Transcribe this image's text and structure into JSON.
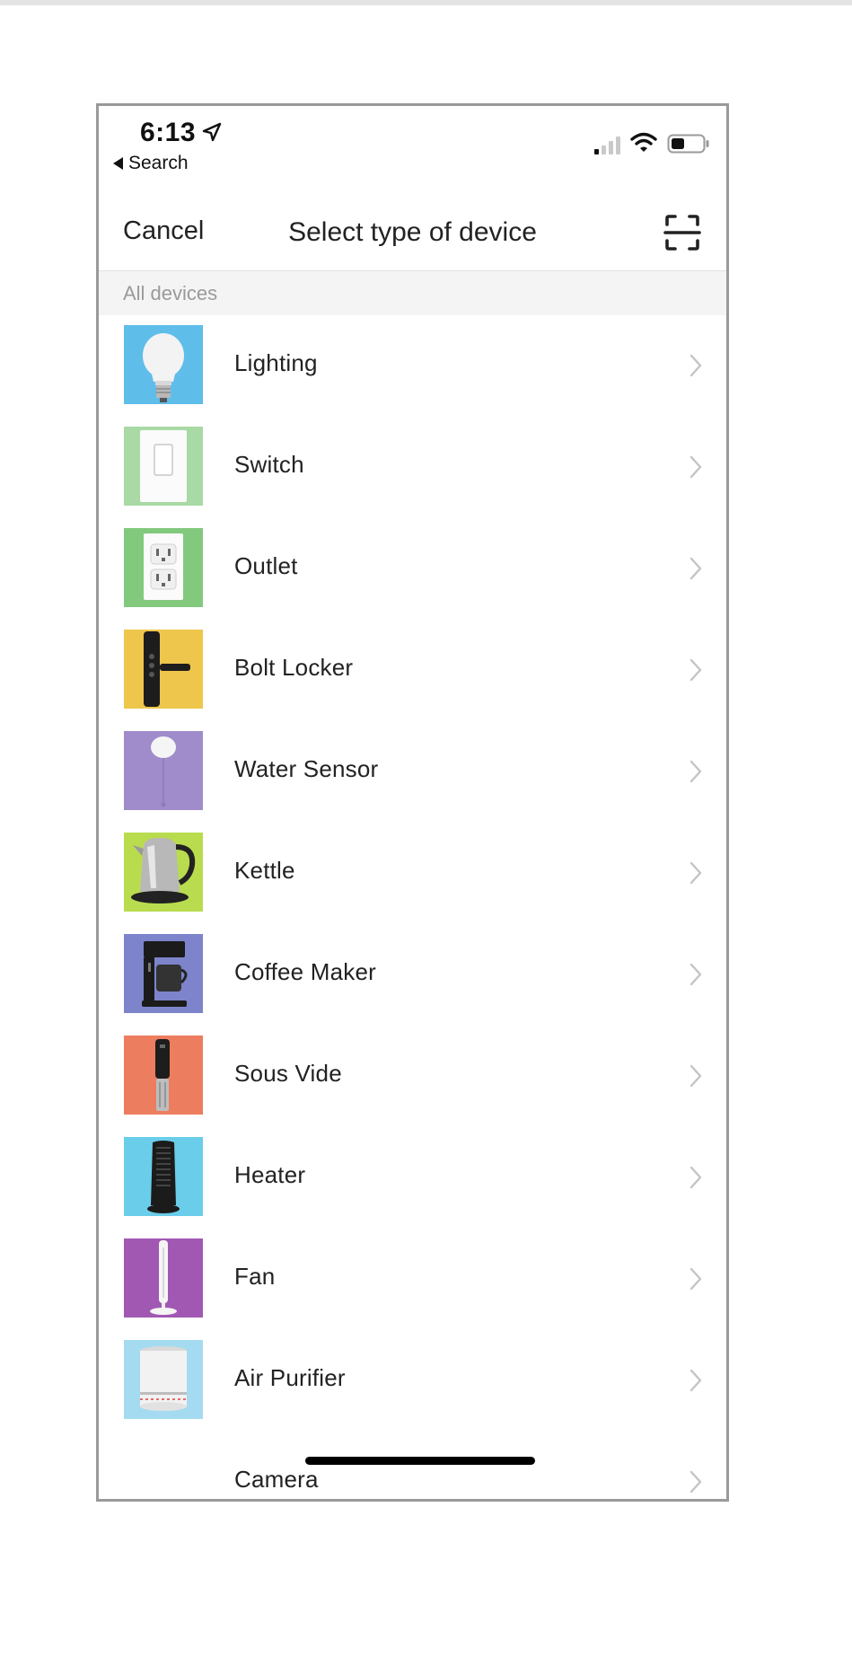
{
  "status_bar": {
    "time": "6:13",
    "back_label": "Search"
  },
  "nav": {
    "cancel_label": "Cancel",
    "title": "Select type of device"
  },
  "section_header": "All devices",
  "devices": [
    {
      "label": "Lighting",
      "icon": "lightbulb-icon",
      "bg": "#5fbdea"
    },
    {
      "label": "Switch",
      "icon": "light-switch-icon",
      "bg": "#a9d9a4"
    },
    {
      "label": "Outlet",
      "icon": "outlet-icon",
      "bg": "#82c97e"
    },
    {
      "label": "Bolt Locker",
      "icon": "door-lock-icon",
      "bg": "#eec64c"
    },
    {
      "label": "Water Sensor",
      "icon": "water-sensor-icon",
      "bg": "#a08cca"
    },
    {
      "label": "Kettle",
      "icon": "kettle-icon",
      "bg": "#b9dc4f"
    },
    {
      "label": "Coffee Maker",
      "icon": "coffee-maker-icon",
      "bg": "#7d84cb"
    },
    {
      "label": "Sous Vide",
      "icon": "sous-vide-icon",
      "bg": "#ec7d5e"
    },
    {
      "label": "Heater",
      "icon": "heater-icon",
      "bg": "#6acde9"
    },
    {
      "label": "Fan",
      "icon": "tower-fan-icon",
      "bg": "#a158b3"
    },
    {
      "label": "Air Purifier",
      "icon": "air-purifier-icon",
      "bg": "#a5dbf1"
    },
    {
      "label": "Camera",
      "icon": "camera-icon",
      "bg": "#ffffff"
    }
  ]
}
